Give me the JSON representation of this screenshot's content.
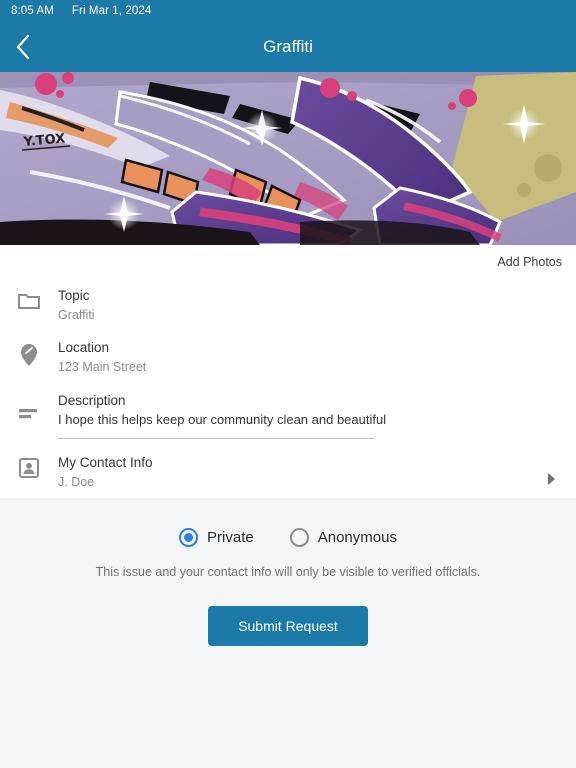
{
  "status_bar": {
    "time": "8:05 AM",
    "date": "Fri Mar 1, 2024"
  },
  "app_bar": {
    "title": "Graffiti",
    "back_icon": "chevron-left-icon"
  },
  "photo": {
    "alt": "graffiti-mural-photo",
    "add_photos_label": "Add Photos"
  },
  "form": {
    "fields": [
      {
        "icon": "folder-icon",
        "label": "Topic",
        "value": "Graffiti",
        "filled": false
      },
      {
        "icon": "location-pin-icon",
        "label": "Location",
        "value": "123 Main Street",
        "filled": false
      },
      {
        "icon": "subject-lines-icon",
        "label": "Description",
        "value": "I hope this helps keep our community clean and beautiful",
        "filled": true
      },
      {
        "icon": "person-icon",
        "label": "My Contact Info",
        "value": "J. Doe",
        "filled": false
      }
    ],
    "contact_chevron_icon": "chevron-right-icon"
  },
  "privacy": {
    "options": [
      {
        "label": "Private",
        "selected": true
      },
      {
        "label": "Anonymous",
        "selected": false
      }
    ],
    "disclaimer": "This issue and your contact info will only be visible to verified officials."
  },
  "submit": {
    "label": "Submit Request"
  },
  "colors": {
    "appbar_blue": "#1d7aa8",
    "radio_blue": "#2b7fe0",
    "panel_gray": "#f4f5f7",
    "text_dark": "#353535",
    "text_muted": "#8c8c8c"
  }
}
